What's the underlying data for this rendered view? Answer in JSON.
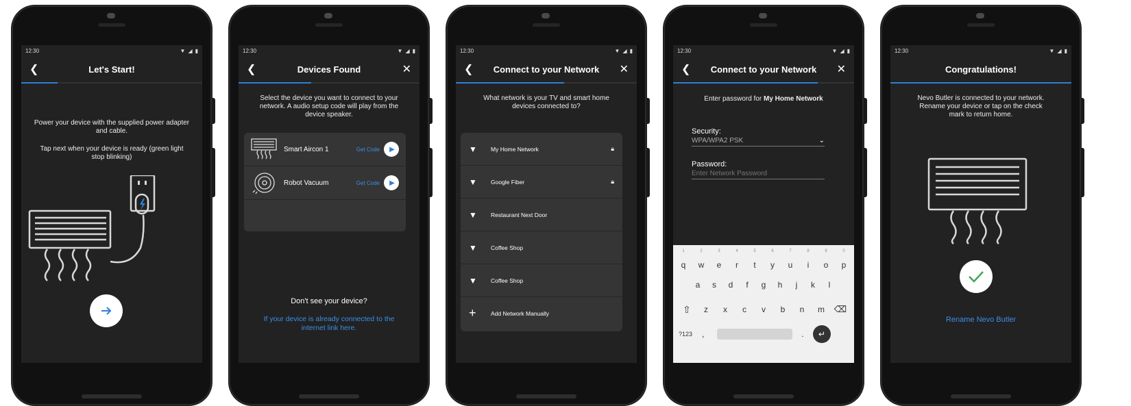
{
  "status_time": "12:30",
  "screens": {
    "start": {
      "title": "Let's Start!",
      "progress": 0.2,
      "instruction1": "Power your device with the supplied power adapter and cable.",
      "instruction2": "Tap next when your device is ready (green light stop blinking)",
      "next_icon": "arrow-right-icon"
    },
    "devices": {
      "title": "Devices Found",
      "progress": 0.4,
      "instruction": "Select the device you want to connect to your network. A audio setup code will play from the device speaker.",
      "items": [
        {
          "name": "Smart Aircon 1",
          "action": "Get Code",
          "icon": "aircon-icon"
        },
        {
          "name": "Robot Vacuum",
          "action": "Get Code",
          "icon": "vacuum-icon"
        }
      ],
      "missing_title": "Don't see your device?",
      "missing_link": "If your device is already connected to the internet link here."
    },
    "network": {
      "title": "Connect to your Network",
      "progress": 0.6,
      "question": "What network is your TV and smart home devices connected to?",
      "networks": [
        {
          "name": "My Home Network",
          "locked": true
        },
        {
          "name": "Google Fiber",
          "locked": true
        },
        {
          "name": "Restaurant Next Door",
          "locked": false
        },
        {
          "name": "Coffee Shop",
          "locked": false
        },
        {
          "name": "Coffee Shop",
          "locked": false
        }
      ],
      "add_manual": "Add Network Manually"
    },
    "password": {
      "title": "Connect to your Network",
      "progress": 0.8,
      "prompt_prefix": "Enter password for",
      "network_name": "My Home Network",
      "security_label": "Security:",
      "security_value": "WPA/WPA2 PSK",
      "password_label": "Password:",
      "password_placeholder": "Enter Network Password",
      "keyboard": {
        "row1": [
          "q",
          "w",
          "e",
          "r",
          "t",
          "y",
          "u",
          "i",
          "o",
          "p"
        ],
        "row1_hints": [
          "1",
          "2",
          "3",
          "4",
          "5",
          "6",
          "7",
          "8",
          "9",
          "0"
        ],
        "row2": [
          "a",
          "s",
          "d",
          "f",
          "g",
          "h",
          "j",
          "k",
          "l"
        ],
        "row3": [
          "z",
          "x",
          "c",
          "v",
          "b",
          "n",
          "m"
        ],
        "symbols": "?123",
        "comma": ",",
        "period": "."
      }
    },
    "congrats": {
      "title": "Congratulations!",
      "progress": 1.0,
      "message": "Nevo Butler is connected to your network. Rename your device or tap on the check mark to return home.",
      "rename_link": "Rename Nevo Butler"
    }
  },
  "colors": {
    "accent": "#2f7fd6",
    "link": "#3d8ee8",
    "screen_bg": "#222222",
    "card_bg": "#353535"
  }
}
